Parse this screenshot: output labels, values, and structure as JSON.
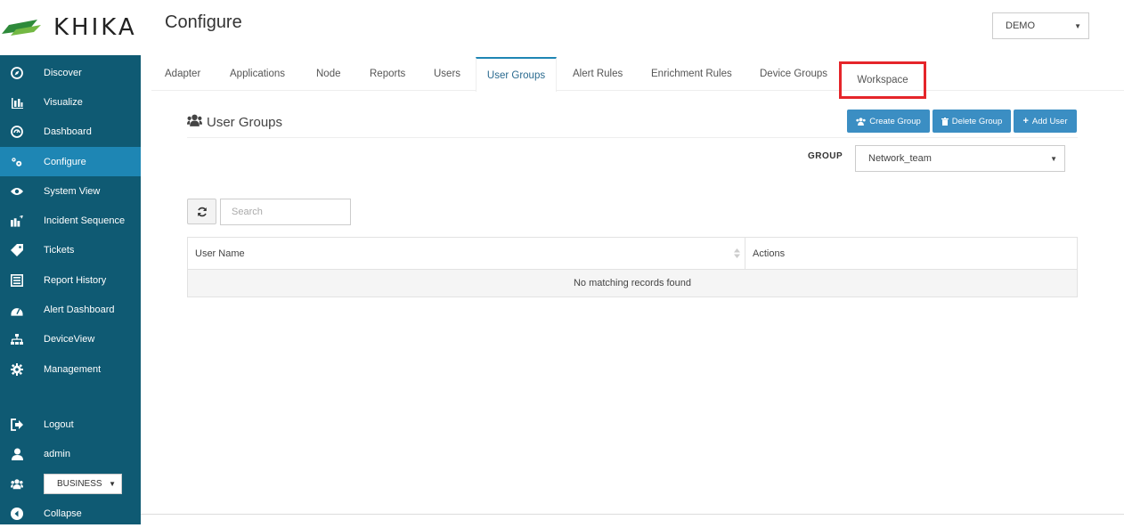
{
  "brand": {
    "logo_text": "KHIKA"
  },
  "header": {
    "title": "Configure",
    "workspace_select": "DEMO"
  },
  "sidebar": {
    "items": [
      {
        "label": "Discover",
        "icon": "compass-icon"
      },
      {
        "label": "Visualize",
        "icon": "bar-chart-icon"
      },
      {
        "label": "Dashboard",
        "icon": "dashboard-gauge-icon"
      },
      {
        "label": "Configure",
        "icon": "cogs-icon",
        "active": true
      },
      {
        "label": "System View",
        "icon": "eye-icon"
      },
      {
        "label": "Incident Sequence",
        "icon": "sequence-chart-icon"
      },
      {
        "label": "Tickets",
        "icon": "tag-icon"
      },
      {
        "label": "Report History",
        "icon": "report-list-icon"
      },
      {
        "label": "Alert Dashboard",
        "icon": "tachometer-icon"
      },
      {
        "label": "DeviceView",
        "icon": "sitemap-icon"
      },
      {
        "label": "Management",
        "icon": "gear-icon"
      }
    ],
    "bottom": {
      "logout": "Logout",
      "user": "admin",
      "business_select": "BUSINESS",
      "collapse": "Collapse"
    }
  },
  "tabs": [
    {
      "label": "Adapter"
    },
    {
      "label": "Applications"
    },
    {
      "label": "Node"
    },
    {
      "label": "Reports"
    },
    {
      "label": "Users"
    },
    {
      "label": "User Groups",
      "active": true
    },
    {
      "label": "Alert Rules"
    },
    {
      "label": "Enrichment Rules"
    },
    {
      "label": "Device Groups"
    },
    {
      "label": "Workspace",
      "highlighted": true
    }
  ],
  "section": {
    "title": "User Groups",
    "buttons": {
      "create": "Create Group",
      "delete": "Delete Group",
      "add_user": "Add User"
    },
    "group_label": "GROUP",
    "group_value": "Network_team"
  },
  "search": {
    "placeholder": "Search"
  },
  "table": {
    "columns": [
      "User Name",
      "Actions"
    ],
    "empty_message": "No matching records found"
  },
  "colors": {
    "sidebar": "#0f5a73",
    "active": "#1e86b4",
    "button": "#3b8ec3",
    "highlight_border": "#e5252a"
  }
}
